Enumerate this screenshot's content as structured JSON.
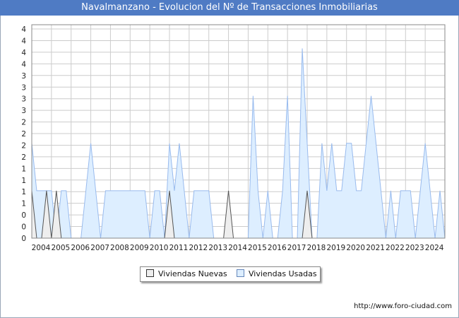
{
  "title": "Navalmanzano - Evolucion del Nº de Transacciones Inmobiliarias",
  "footer_url": "http://www.foro-ciudad.com",
  "legend": {
    "nuevas_label": "Viviendas Nuevas",
    "usadas_label": "Viviendas Usadas"
  },
  "colors": {
    "title_bg": "#4f7bc4",
    "nuevas_fill": "#eeeeee",
    "nuevas_line": "#555555",
    "usadas_fill": "#ddeeff",
    "usadas_line": "#99bbee",
    "grid": "#cccccc"
  },
  "chart_data": {
    "type": "area",
    "title": "Navalmanzano - Evolucion del Nº de Transacciones Inmobiliarias",
    "x_unit": "quarter",
    "x_start": "2004-Q1",
    "x_end": "2024-Q4",
    "xlim": [
      2004,
      2025
    ],
    "ylim": [
      0,
      4.5
    ],
    "y_tick_labels": [
      "0",
      "0",
      "0",
      "1",
      "1",
      "1",
      "1",
      "2",
      "2",
      "2",
      "2",
      "3",
      "3",
      "3",
      "3",
      "4",
      "4",
      "4",
      "4"
    ],
    "x_tick_labels": [
      "2004",
      "2005",
      "2006",
      "2007",
      "2008",
      "2009",
      "2010",
      "2011",
      "2012",
      "2013",
      "2014",
      "2015",
      "2016",
      "2017",
      "2018",
      "2019",
      "2020",
      "2021",
      "2022",
      "2023",
      "2024"
    ],
    "grid": true,
    "legend_position": "bottom-center",
    "series": [
      {
        "name": "Viviendas Nuevas",
        "values": [
          1,
          0,
          0,
          1,
          0,
          1,
          0,
          0,
          0,
          0,
          0,
          0,
          0,
          0,
          0,
          0,
          0,
          0,
          0,
          0,
          0,
          0,
          0,
          0,
          0,
          0,
          0,
          0,
          1,
          0,
          0,
          0,
          0,
          0,
          0,
          0,
          0,
          0,
          0,
          0,
          1,
          0,
          0,
          0,
          0,
          0,
          0,
          0,
          0,
          0,
          0,
          0,
          0,
          0,
          0,
          0,
          1,
          0,
          0,
          0,
          0,
          0,
          0,
          0,
          0,
          0,
          0,
          0,
          0,
          0,
          0,
          0,
          0,
          0,
          0,
          0,
          0,
          0,
          0,
          0,
          0,
          0,
          0,
          0,
          0
        ]
      },
      {
        "name": "Viviendas Usadas",
        "values": [
          2,
          1,
          1,
          1,
          1,
          0,
          1,
          1,
          0,
          0,
          0,
          1,
          2,
          1,
          0,
          1,
          1,
          1,
          1,
          1,
          1,
          1,
          1,
          1,
          0,
          1,
          1,
          0,
          2,
          1,
          2,
          1,
          0,
          1,
          1,
          1,
          1,
          0,
          0,
          0,
          0,
          0,
          0,
          0,
          0,
          3,
          1,
          0,
          1,
          0,
          0,
          1,
          3,
          0,
          0,
          4,
          2,
          0,
          0,
          2,
          1,
          2,
          1,
          1,
          2,
          2,
          1,
          1,
          2,
          3,
          2,
          1,
          0,
          1,
          0,
          1,
          1,
          1,
          0,
          1,
          2,
          1,
          0,
          1,
          0,
          2,
          0,
          0,
          0,
          1,
          0
        ]
      }
    ]
  }
}
